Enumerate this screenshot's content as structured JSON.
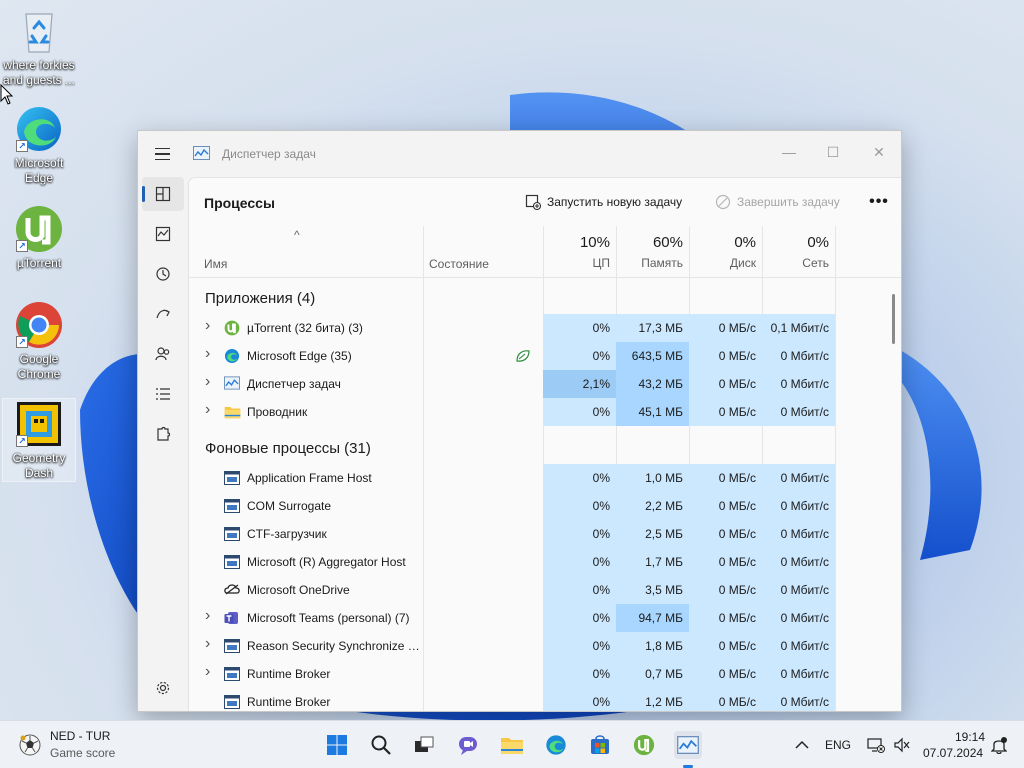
{
  "desktop": {
    "icons": [
      {
        "label": "where forkies and guests ...",
        "icon": "recycle-bin-icon"
      },
      {
        "label": "Microsoft Edge",
        "icon": "edge-icon"
      },
      {
        "label": "µTorrent",
        "icon": "utorrent-icon"
      },
      {
        "label": "Google Chrome",
        "icon": "chrome-icon"
      },
      {
        "label": "Geometry Dash",
        "icon": "geometry-dash-icon"
      }
    ]
  },
  "window": {
    "title": "Диспетчер задач",
    "page_title": "Процессы",
    "run_task_label": "Запустить новую задачу",
    "end_task_label": "Завершить задачу",
    "more_label": "•••",
    "controls": {
      "minimize": "—",
      "maximize": "☐",
      "close": "✕"
    }
  },
  "columns": {
    "name": "Имя",
    "status": "Состояние",
    "cpu": {
      "pct": "10%",
      "label": "ЦП"
    },
    "memory": {
      "pct": "60%",
      "label": "Память"
    },
    "disk": {
      "pct": "0%",
      "label": "Диск"
    },
    "network": {
      "pct": "0%",
      "label": "Сеть"
    },
    "sort_indicator": "^"
  },
  "groups": {
    "apps": "Приложения (4)",
    "background": "Фоновые процессы (31)"
  },
  "apps": [
    {
      "name": "µTorrent (32 бита) (3)",
      "icon": "utorrent-icon",
      "expand": true,
      "cpu": "0%",
      "mem": "17,3 МБ",
      "disk": "0 МБ/с",
      "net": "0,1 Мбит/с"
    },
    {
      "name": "Microsoft Edge (35)",
      "icon": "edge-icon",
      "expand": true,
      "status_icon": "efficiency-leaf-icon",
      "cpu": "0%",
      "mem": "643,5 МБ",
      "disk": "0 МБ/с",
      "net": "0 Мбит/с"
    },
    {
      "name": "Диспетчер задач",
      "icon": "task-manager-icon",
      "expand": true,
      "cpu": "2,1%",
      "mem": "43,2 МБ",
      "disk": "0 МБ/с",
      "net": "0 Мбит/с"
    },
    {
      "name": "Проводник",
      "icon": "folder-icon",
      "expand": true,
      "cpu": "0%",
      "mem": "45,1 МБ",
      "disk": "0 МБ/с",
      "net": "0 Мбит/с"
    }
  ],
  "background": [
    {
      "name": "Application Frame Host",
      "icon": "process-window-icon",
      "expand": false,
      "cpu": "0%",
      "mem": "1,0 МБ",
      "disk": "0 МБ/с",
      "net": "0 Мбит/с"
    },
    {
      "name": "COM Surrogate",
      "icon": "process-window-icon",
      "expand": false,
      "cpu": "0%",
      "mem": "2,2 МБ",
      "disk": "0 МБ/с",
      "net": "0 Мбит/с"
    },
    {
      "name": "CTF-загрузчик",
      "icon": "process-window-icon",
      "expand": false,
      "cpu": "0%",
      "mem": "2,5 МБ",
      "disk": "0 МБ/с",
      "net": "0 Мбит/с"
    },
    {
      "name": "Microsoft (R) Aggregator Host",
      "icon": "process-window-icon",
      "expand": false,
      "cpu": "0%",
      "mem": "1,7 МБ",
      "disk": "0 МБ/с",
      "net": "0 Мбит/с"
    },
    {
      "name": "Microsoft OneDrive",
      "icon": "onedrive-icon",
      "expand": false,
      "cpu": "0%",
      "mem": "3,5 МБ",
      "disk": "0 МБ/с",
      "net": "0 Мбит/с"
    },
    {
      "name": "Microsoft Teams (personal) (7)",
      "icon": "teams-icon",
      "expand": true,
      "cpu": "0%",
      "mem": "94,7 МБ",
      "disk": "0 МБ/с",
      "net": "0 Мбит/с"
    },
    {
      "name": "Reason Security Synchronize S...",
      "icon": "process-window-icon",
      "expand": true,
      "cpu": "0%",
      "mem": "1,8 МБ",
      "disk": "0 МБ/с",
      "net": "0 Мбит/с"
    },
    {
      "name": "Runtime Broker",
      "icon": "process-window-icon",
      "expand": true,
      "cpu": "0%",
      "mem": "0,7 МБ",
      "disk": "0 МБ/с",
      "net": "0 Мбит/с"
    },
    {
      "name": "Runtime Broker",
      "icon": "process-window-icon",
      "expand": false,
      "cpu": "0%",
      "mem": "1,2 МБ",
      "disk": "0 МБ/с",
      "net": "0 Мбит/с"
    }
  ],
  "colors": {
    "heat_low": "#cce8ff",
    "heat_mid": "#a8d6ff",
    "heat_high": "#9ccbf5",
    "accent": "#1f5fb4"
  },
  "taskbar": {
    "widget_title": "NED - TUR",
    "widget_subtitle": "Game score",
    "language": "ENG",
    "time": "19:14",
    "date": "07.07.2024"
  }
}
